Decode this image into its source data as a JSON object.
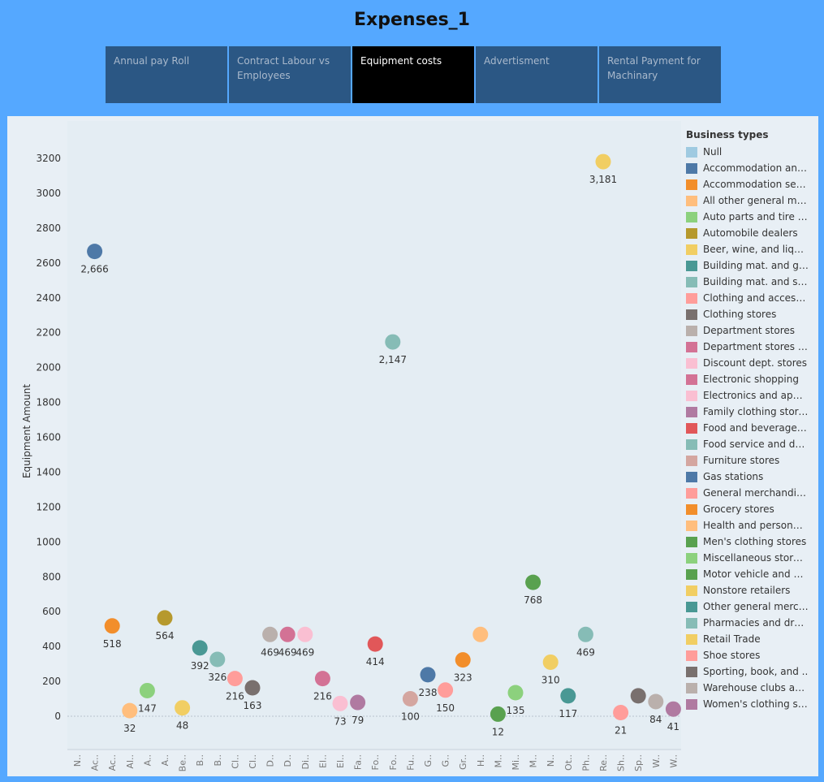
{
  "title": "Expenses_1",
  "tabs": [
    {
      "label": "Annual pay Roll",
      "active": false
    },
    {
      "label": "Contract Labour vs Employees",
      "active": false
    },
    {
      "label": "Equipment costs",
      "active": true
    },
    {
      "label": "Advertisment",
      "active": false
    },
    {
      "label": "Rental Payment for Machinary",
      "active": false
    }
  ],
  "legend": {
    "title": "Business types",
    "items": [
      {
        "label": "Null",
        "color": "#9fcae1"
      },
      {
        "label": "Accommodation and f..",
        "color": "#4e79a7"
      },
      {
        "label": "Accommodation servi..",
        "color": "#f28e2b"
      },
      {
        "label": "All other general mer..",
        "color": "#ffbe7d"
      },
      {
        "label": "Auto parts and tire st..",
        "color": "#8cd17d"
      },
      {
        "label": "Automobile dealers",
        "color": "#b6992d"
      },
      {
        "label": "Beer, wine, and liquo..",
        "color": "#f1ce63"
      },
      {
        "label": "Building mat. and gar..",
        "color": "#499894"
      },
      {
        "label": "Building mat. and sup..",
        "color": "#86bcb6"
      },
      {
        "label": "Clothing and accesso..",
        "color": "#ff9d9a"
      },
      {
        "label": "Clothing stores",
        "color": "#79706e"
      },
      {
        "label": "Department stores",
        "color": "#bab0ac"
      },
      {
        "label": "Department stores (e..",
        "color": "#d37295"
      },
      {
        "label": "Discount dept. stores",
        "color": "#fabfd2"
      },
      {
        "label": "Electronic shopping",
        "color": "#d37295"
      },
      {
        "label": "Electronics and appli..",
        "color": "#fabfd2"
      },
      {
        "label": "Family clothing stores",
        "color": "#b07aa1"
      },
      {
        "label": "Food and beverage st..",
        "color": "#e15759"
      },
      {
        "label": "Food service and drin..",
        "color": "#86bcb6"
      },
      {
        "label": "Furniture stores",
        "color": "#d4a6a0"
      },
      {
        "label": "Gas stations",
        "color": "#4e79a7"
      },
      {
        "label": "General merchandise ..",
        "color": "#ff9d9a"
      },
      {
        "label": "Grocery stores",
        "color": "#f28e2b"
      },
      {
        "label": "Health and personal c..",
        "color": "#ffbe7d"
      },
      {
        "label": "Men's clothing stores",
        "color": "#59a14f"
      },
      {
        "label": "Miscellaneous store r..",
        "color": "#8cd17d"
      },
      {
        "label": "Motor vehicle and par..",
        "color": "#59a14f"
      },
      {
        "label": "Nonstore retailers",
        "color": "#f1ce63"
      },
      {
        "label": "Other general merch..",
        "color": "#499894"
      },
      {
        "label": "Pharmacies and drug ..",
        "color": "#86bcb6"
      },
      {
        "label": "Retail Trade",
        "color": "#f1ce63"
      },
      {
        "label": "Shoe stores",
        "color": "#ff9d9a"
      },
      {
        "label": "Sporting, book, and ..",
        "color": "#79706e"
      },
      {
        "label": "Warehouse clubs and ..",
        "color": "#bab0ac"
      },
      {
        "label": "Women's clothing sto..",
        "color": "#b07aa1"
      }
    ]
  },
  "chart_data": {
    "type": "scatter",
    "ylabel": "Equipment Amount",
    "ylim": [
      -200,
      3300
    ],
    "yticks": [
      0,
      200,
      400,
      600,
      800,
      1000,
      1200,
      1400,
      1600,
      1800,
      2000,
      2200,
      2400,
      2600,
      2800,
      3000,
      3200
    ],
    "grid": false,
    "legend_position": "right",
    "categories": [
      "N..",
      "Ac..",
      "Ac..",
      "Al..",
      "A..",
      "A..",
      "Be..",
      "B..",
      "B..",
      "Cl..",
      "Cl..",
      "D..",
      "D..",
      "Di..",
      "El..",
      "El..",
      "Fa..",
      "Fo..",
      "Fo..",
      "Fu..",
      "G..",
      "G..",
      "Gr..",
      "H..",
      "M..",
      "Mi..",
      "M..",
      "N..",
      "Ot..",
      "Ph..",
      "Re..",
      "Sh..",
      "Sp..",
      "W..",
      "W.."
    ],
    "points": [
      {
        "category": 1,
        "value": 2666,
        "label": "2,666",
        "color": "#4e79a7"
      },
      {
        "category": 2,
        "value": 518,
        "label": "518",
        "color": "#f28e2b"
      },
      {
        "category": 3,
        "value": 32,
        "label": "32",
        "color": "#ffbe7d"
      },
      {
        "category": 4,
        "value": 147,
        "label": "147",
        "color": "#8cd17d"
      },
      {
        "category": 5,
        "value": 564,
        "label": "564",
        "color": "#b6992d"
      },
      {
        "category": 6,
        "value": 48,
        "label": "48",
        "color": "#f1ce63"
      },
      {
        "category": 7,
        "value": 392,
        "label": "392",
        "color": "#499894"
      },
      {
        "category": 8,
        "value": 326,
        "label": "326",
        "color": "#86bcb6"
      },
      {
        "category": 9,
        "value": 216,
        "label": "216",
        "color": "#ff9d9a"
      },
      {
        "category": 10,
        "value": 163,
        "label": "163",
        "color": "#79706e"
      },
      {
        "category": 11,
        "value": 469,
        "label": "469",
        "color": "#bab0ac"
      },
      {
        "category": 12,
        "value": 469,
        "label": "469",
        "color": "#d37295"
      },
      {
        "category": 13,
        "value": 469,
        "label": "469",
        "color": "#fabfd2"
      },
      {
        "category": 14,
        "value": 216,
        "label": "216",
        "color": "#d37295"
      },
      {
        "category": 15,
        "value": 73,
        "label": "73",
        "color": "#fabfd2"
      },
      {
        "category": 16,
        "value": 79,
        "label": "79",
        "color": "#b07aa1"
      },
      {
        "category": 17,
        "value": 414,
        "label": "414",
        "color": "#e15759"
      },
      {
        "category": 18,
        "value": 2147,
        "label": "2,147",
        "color": "#86bcb6"
      },
      {
        "category": 19,
        "value": 100,
        "label": "100",
        "color": "#d4a6a0"
      },
      {
        "category": 20,
        "value": 238,
        "label": "238",
        "color": "#4e79a7"
      },
      {
        "category": 21,
        "value": 150,
        "label": "150",
        "color": "#ff9d9a"
      },
      {
        "category": 22,
        "value": 323,
        "label": "323",
        "color": "#f28e2b"
      },
      {
        "category": 23,
        "value": 469,
        "label": "",
        "color": "#ffbe7d"
      },
      {
        "category": 24,
        "value": 12,
        "label": "12",
        "color": "#59a14f"
      },
      {
        "category": 25,
        "value": 135,
        "label": "135",
        "color": "#8cd17d"
      },
      {
        "category": 26,
        "value": 768,
        "label": "768",
        "color": "#59a14f"
      },
      {
        "category": 27,
        "value": 310,
        "label": "310",
        "color": "#f1ce63"
      },
      {
        "category": 28,
        "value": 117,
        "label": "117",
        "color": "#499894"
      },
      {
        "category": 29,
        "value": 469,
        "label": "469",
        "color": "#86bcb6"
      },
      {
        "category": 30,
        "value": 3181,
        "label": "3,181",
        "color": "#f1ce63"
      },
      {
        "category": 31,
        "value": 21,
        "label": "21",
        "color": "#ff9d9a"
      },
      {
        "category": 32,
        "value": 117,
        "label": "",
        "color": "#79706e"
      },
      {
        "category": 33,
        "value": 84,
        "label": "84",
        "color": "#bab0ac"
      },
      {
        "category": 34,
        "value": 41,
        "label": "41",
        "color": "#b07aa1"
      }
    ]
  }
}
